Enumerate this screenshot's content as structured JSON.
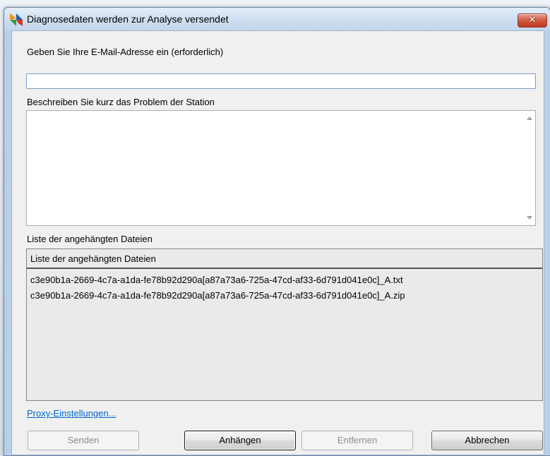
{
  "window": {
    "title": "Diagnosedaten werden zur Analyse versendet",
    "close_label": "✕"
  },
  "form": {
    "email_label": "Geben Sie Ihre E-Mail-Adresse ein (erforderlich)",
    "email_value": "",
    "problem_label": "Beschreiben Sie kurz das Problem der Station",
    "problem_value": ""
  },
  "attachments": {
    "section_label": "Liste der angehängten Dateien",
    "column_header": "Liste der angehängten Dateien",
    "files": [
      "c3e90b1a-2669-4c7a-a1da-fe78b92d290a[a87a73a6-725a-47cd-af33-6d791d041e0c]_A.txt",
      "c3e90b1a-2669-4c7a-a1da-fe78b92d290a[a87a73a6-725a-47cd-af33-6d791d041e0c]_A.zip"
    ]
  },
  "proxy_link": "Proxy-Einstellungen...",
  "buttons": {
    "send": "Senden",
    "attach": "Anhängen",
    "remove": "Entfernen",
    "cancel": "Abbrechen"
  },
  "icons": {
    "app": "avg-logo-icon",
    "close": "close-icon",
    "scroll_up": "scroll-up-arrow-icon",
    "scroll_down": "scroll-down-arrow-icon"
  },
  "colors": {
    "link": "#0066cc",
    "close_button": "#c03a22",
    "logo_orange": "#f28c1e",
    "logo_blue": "#1f5fa8",
    "logo_green": "#3b9b3b",
    "logo_red": "#d8322b"
  }
}
